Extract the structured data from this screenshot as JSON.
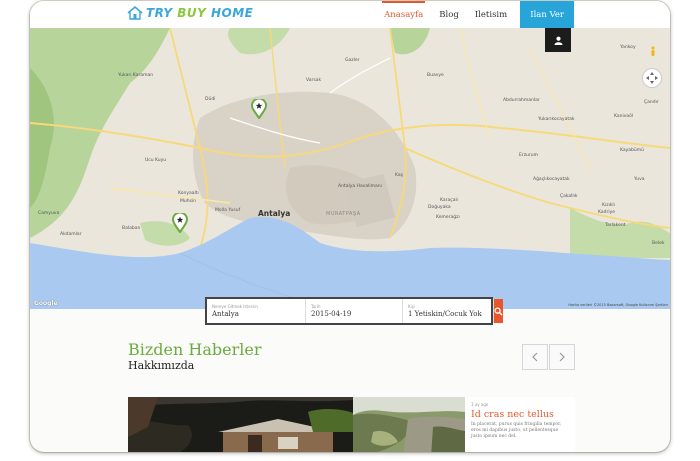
{
  "brand": {
    "logo_parts": [
      "TRY ",
      "BUY ",
      "HOME"
    ],
    "icon": "house-icon"
  },
  "nav": {
    "items": [
      {
        "label": "Anasayfa",
        "active": true
      },
      {
        "label": "Blog",
        "active": false
      },
      {
        "label": "Iletisim",
        "active": false
      }
    ],
    "cta": "Ilan Ver",
    "user_icon": "user-icon"
  },
  "map": {
    "city": "Antalya",
    "district": "MURATPAŞA",
    "labels": [
      "Yukarı Karaman",
      "Gazler",
      "Buavye",
      "Varsak",
      "Abdurrahmanlar",
      "Düdi",
      "Yukarıkocayatak",
      "Kanivaöl",
      "Antalya Havalimanı",
      "Kaş",
      "Kayabümü",
      "Kızıklı",
      "Erzurum",
      "Konyaaltı",
      "Muhsin",
      "Akdamlar",
      "Molla Yusuf",
      "Doğuyaka",
      "Ağaçlıkocayatak",
      "Çakallık",
      "Kadriye",
      "Kemerağzı",
      "Belek",
      "Camyuva",
      "Ucu Kuyu",
      "Karaçalı",
      "Tarlakent",
      "Yuva",
      "Balaban",
      "Yankoy",
      "Çandır"
    ],
    "copyright": "Harita verileri ©2015 Basarsoft, Google",
    "terms": "Kullanım Şartları",
    "google": "Google",
    "colors": {
      "land": "#eae6dc",
      "urban": "#d9d3c7",
      "green": "#b7d49a",
      "water": "#a9c9f0",
      "road": "#f7d97a"
    }
  },
  "search": {
    "fields": [
      {
        "label": "Nereye Gitmek Istersin",
        "value": "Antalya"
      },
      {
        "label": "Tarih",
        "value": "2015-04-19"
      },
      {
        "label": "Kişi",
        "value": "1 Yetiskin/Cocuk Yok"
      }
    ],
    "button_icon": "search-icon",
    "button_color": "#e8562c"
  },
  "news": {
    "title": "Bizden Haberler",
    "subtitle": "Hakkımızda",
    "prev_icon": "chevron-left-icon",
    "next_icon": "chevron-right-icon",
    "card": {
      "date": "3 ay ago",
      "title": "Id cras nec tellus",
      "body": "In placerat, purus quis fringilla tempor, eros mi dapibus justo, ut pellentesque justo ipsum nec del."
    }
  },
  "accent_colors": {
    "orange": "#e5582d",
    "green": "#6aab3f",
    "blue": "#27a4d8"
  }
}
